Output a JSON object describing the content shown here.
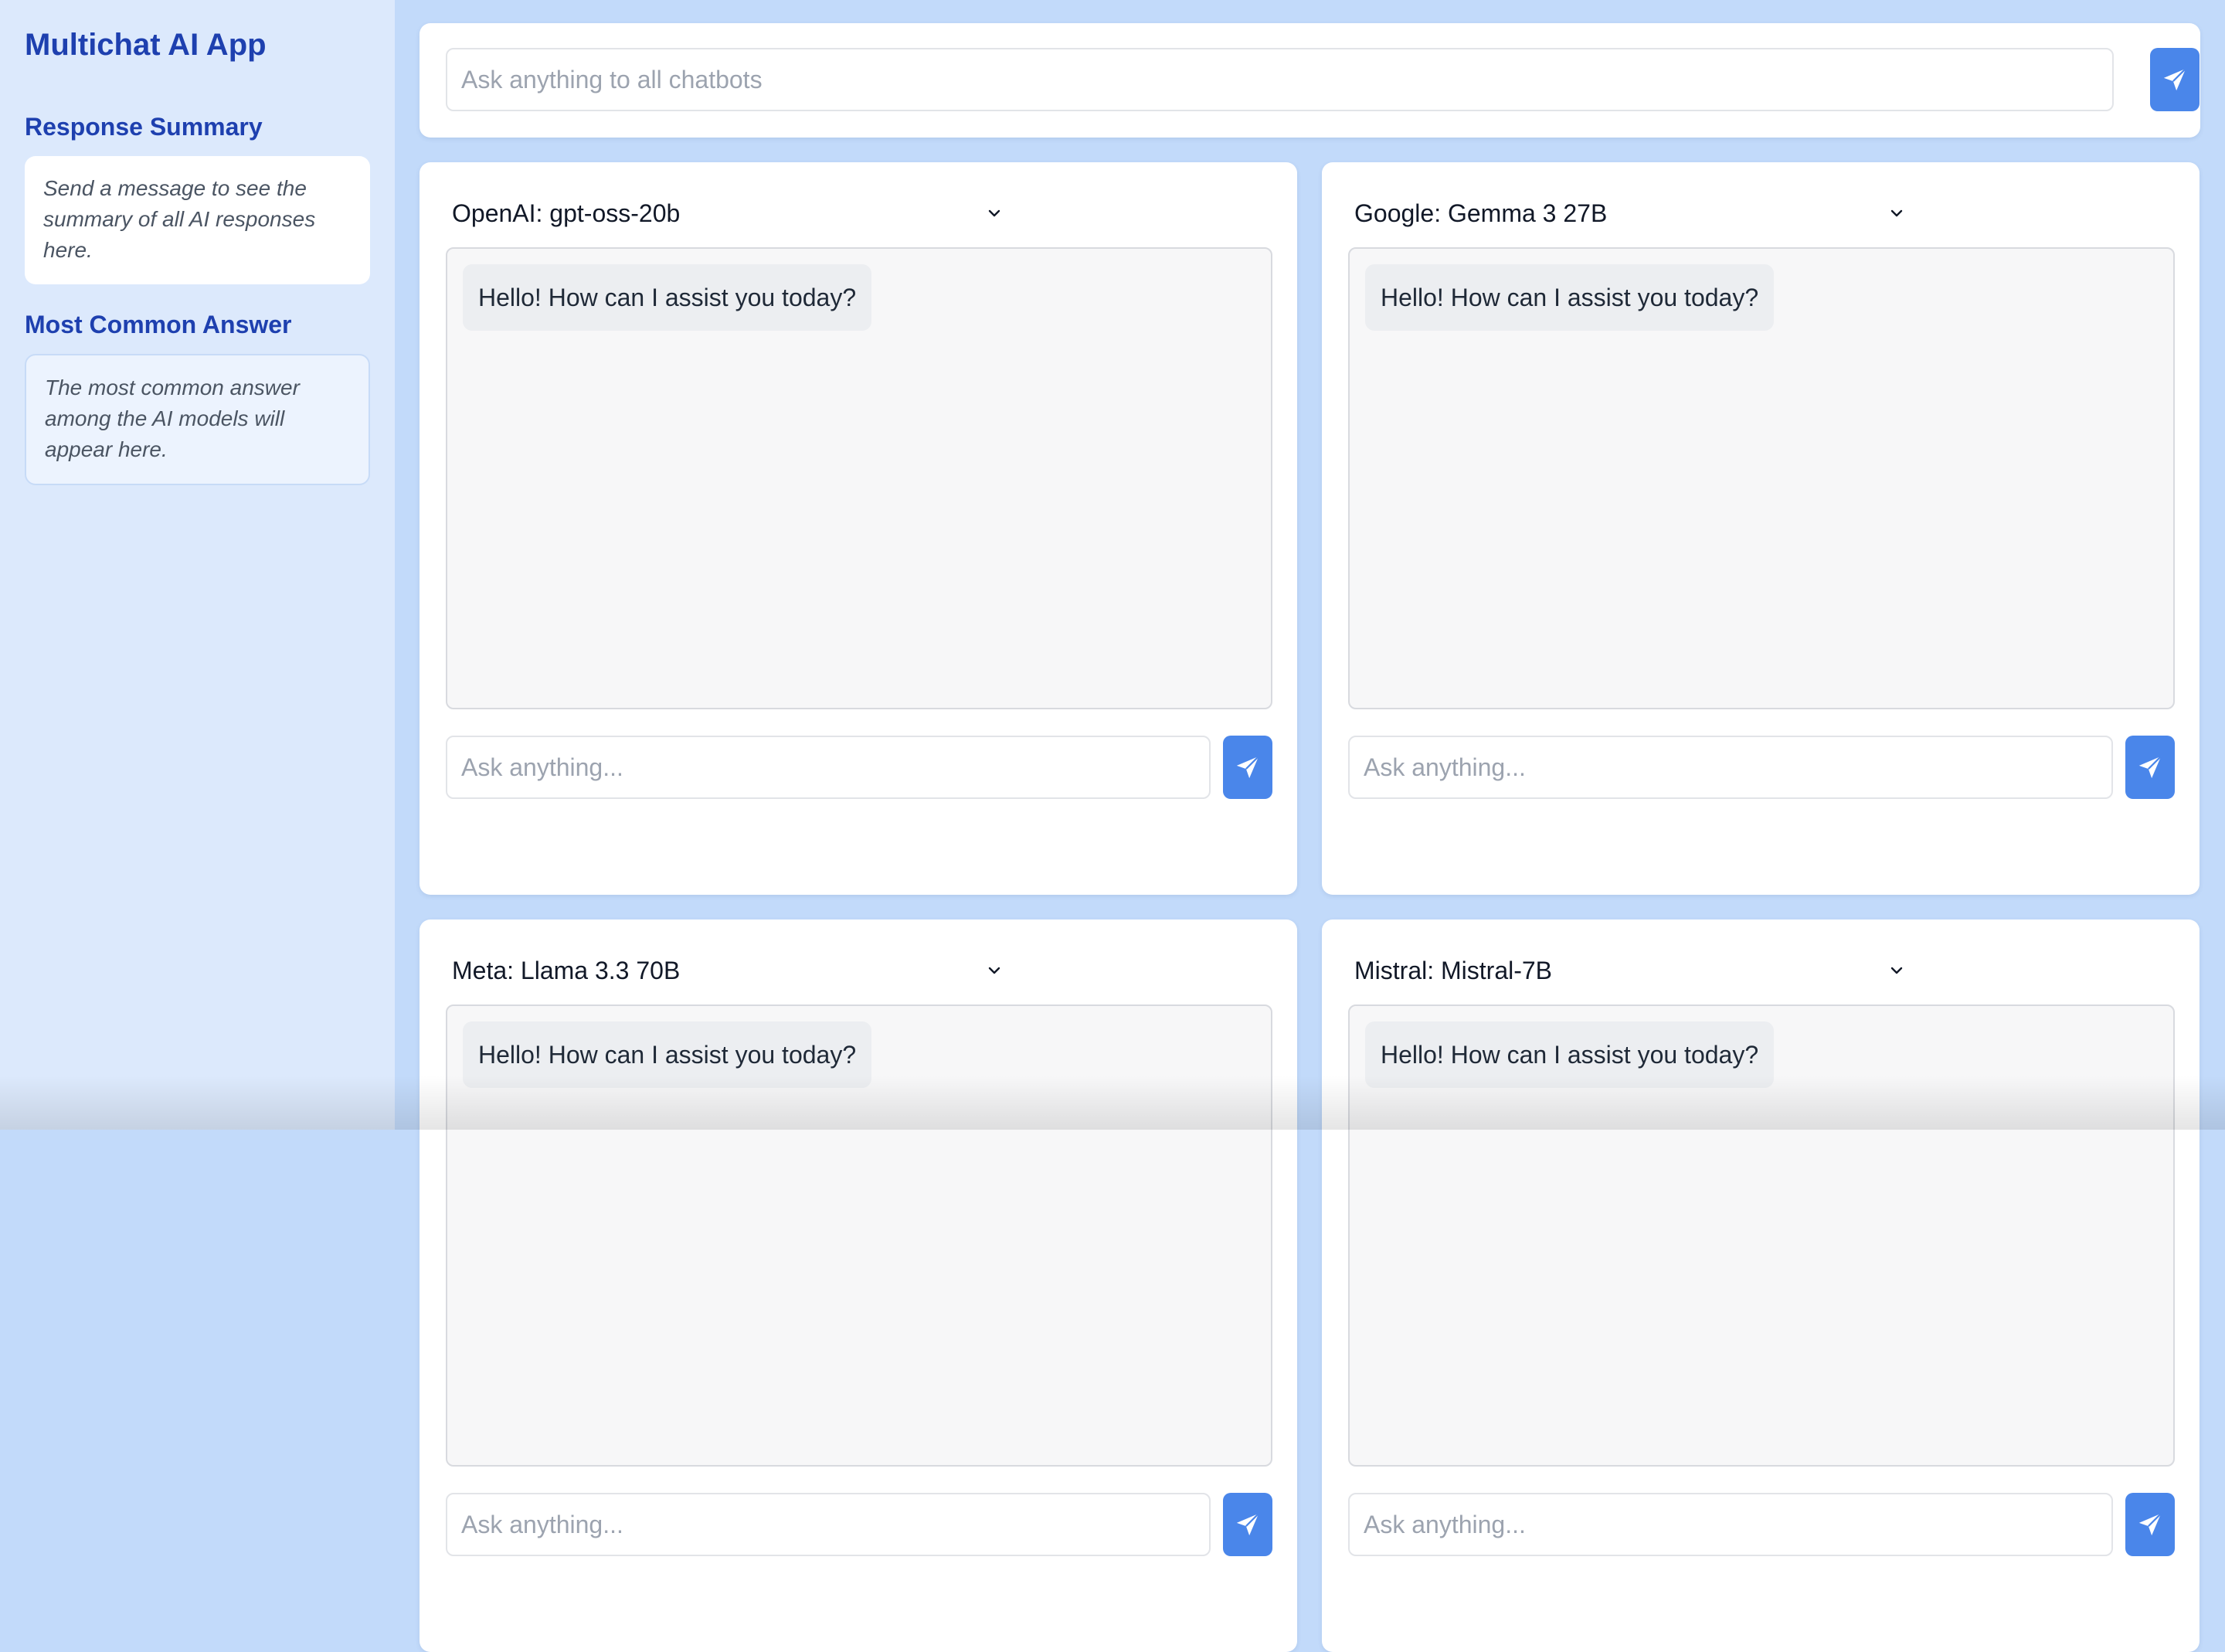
{
  "app": {
    "title": "Multichat AI App"
  },
  "sidebar": {
    "summary": {
      "title": "Response Summary",
      "text": "Send a message to see the summary of all AI responses here."
    },
    "common": {
      "title": "Most Common Answer",
      "text": "The most common answer among the AI models will appear here."
    }
  },
  "broadcast": {
    "placeholder": "Ask anything to all chatbots",
    "value": ""
  },
  "panels": [
    {
      "model": "OpenAI: gpt-oss-20b",
      "message": "Hello! How can I assist you today?",
      "placeholder": "Ask anything..."
    },
    {
      "model": "Google: Gemma 3 27B",
      "message": "Hello! How can I assist you today?",
      "placeholder": "Ask anything..."
    },
    {
      "model": "Meta: Llama 3.3 70B",
      "message": "Hello! How can I assist you today?",
      "placeholder": "Ask anything..."
    },
    {
      "model": "Mistral: Mistral-7B",
      "message": "Hello! How can I assist you today?",
      "placeholder": "Ask anything..."
    }
  ],
  "icons": {
    "send": "send-icon",
    "dropdown": "chevron-down-icon"
  },
  "colors": {
    "accent": "#4a86ea",
    "title": "#1e40af",
    "background": "#c2dafa",
    "sidebar": "#dce9fc"
  }
}
